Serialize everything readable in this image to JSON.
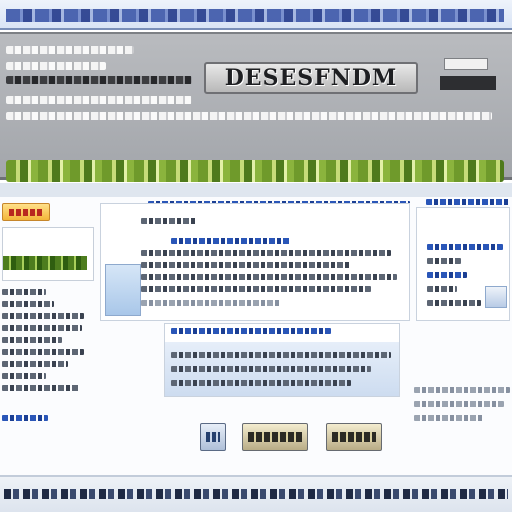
{
  "header": {
    "logo_text": "DESESFNDM"
  },
  "colors": {
    "header_bg": "#a3a6ab",
    "accent_green": "#6f9a2b",
    "accent_blue": "#2a56b8",
    "button_beige": "#b9ac86"
  },
  "main": {
    "buttons": [
      {
        "icon": "image-icon"
      },
      {
        "icon": "button"
      },
      {
        "icon": "button"
      }
    ]
  }
}
